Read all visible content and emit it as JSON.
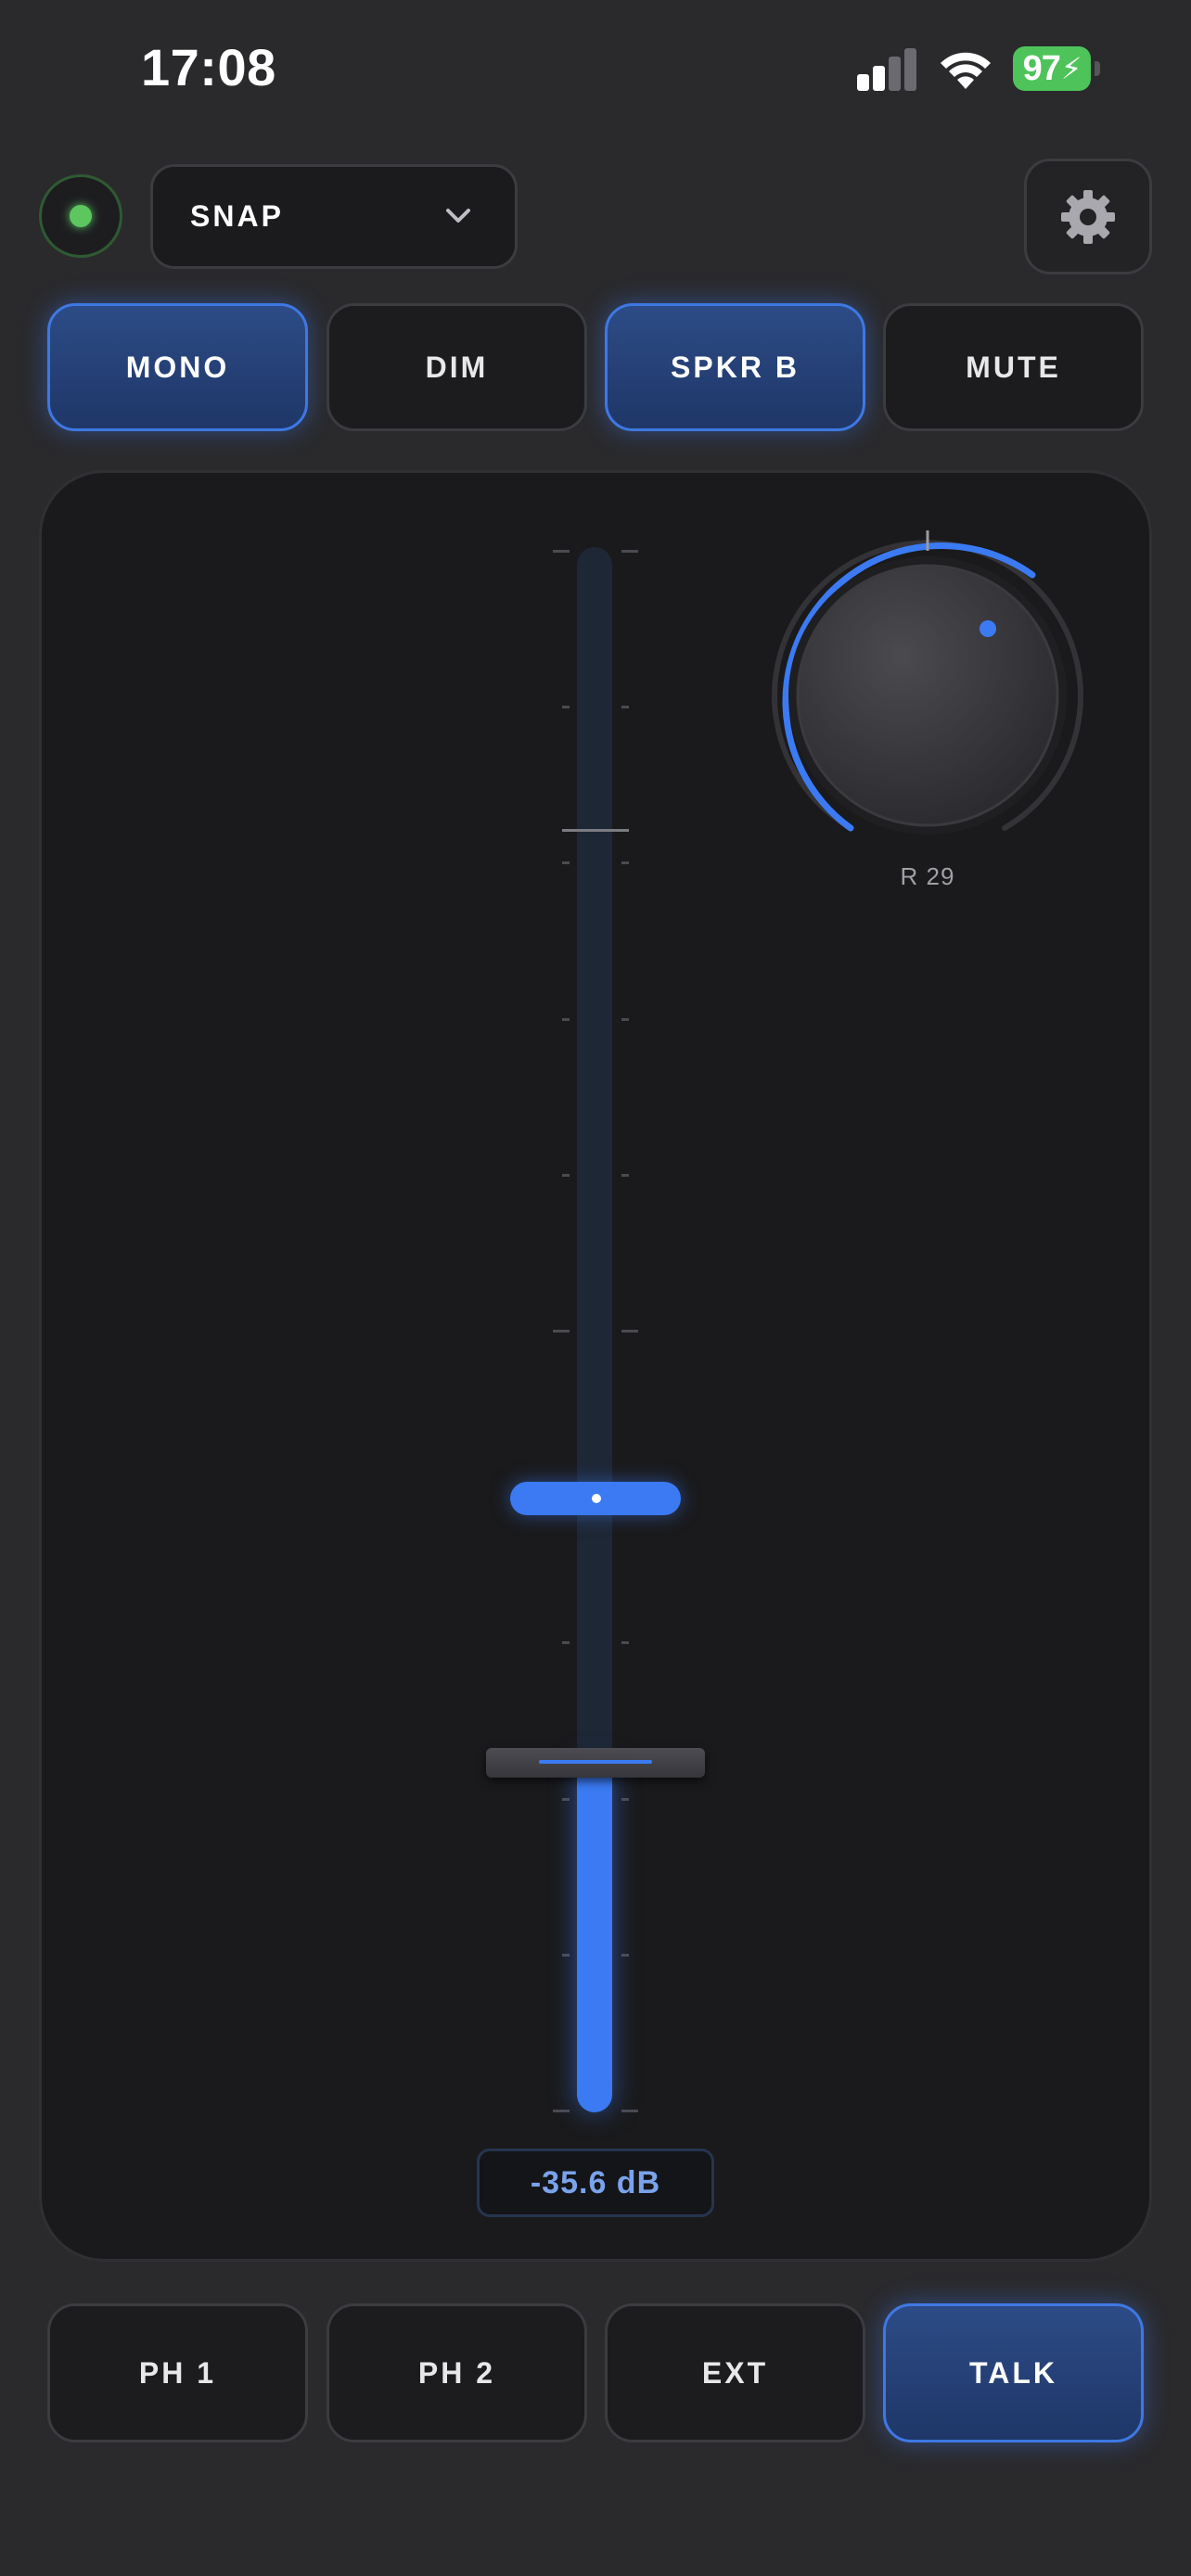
{
  "status_bar": {
    "time": "17:08",
    "battery_percent": "97",
    "battery_color": "#4ec35a",
    "signal_bars_active": 2,
    "signal_bars_total": 4
  },
  "header": {
    "status_led_color": "#5cc75f",
    "preset_label": "SNAP",
    "preset_icon": "chevron-down-icon",
    "settings_icon": "gear-icon"
  },
  "top_buttons": [
    {
      "label": "MONO",
      "active": true
    },
    {
      "label": "DIM",
      "active": false
    },
    {
      "label": "SPKR B",
      "active": true
    },
    {
      "label": "MUTE",
      "active": false
    }
  ],
  "fader": {
    "value_text": "-35.6 dB",
    "accent_color": "#3b7af3"
  },
  "knob": {
    "label": "R 29",
    "accent_color": "#3b7af3"
  },
  "bottom_buttons": [
    {
      "label": "PH 1",
      "active": false
    },
    {
      "label": "PH 2",
      "active": false
    },
    {
      "label": "EXT",
      "active": false
    },
    {
      "label": "TALK",
      "active": true
    }
  ]
}
